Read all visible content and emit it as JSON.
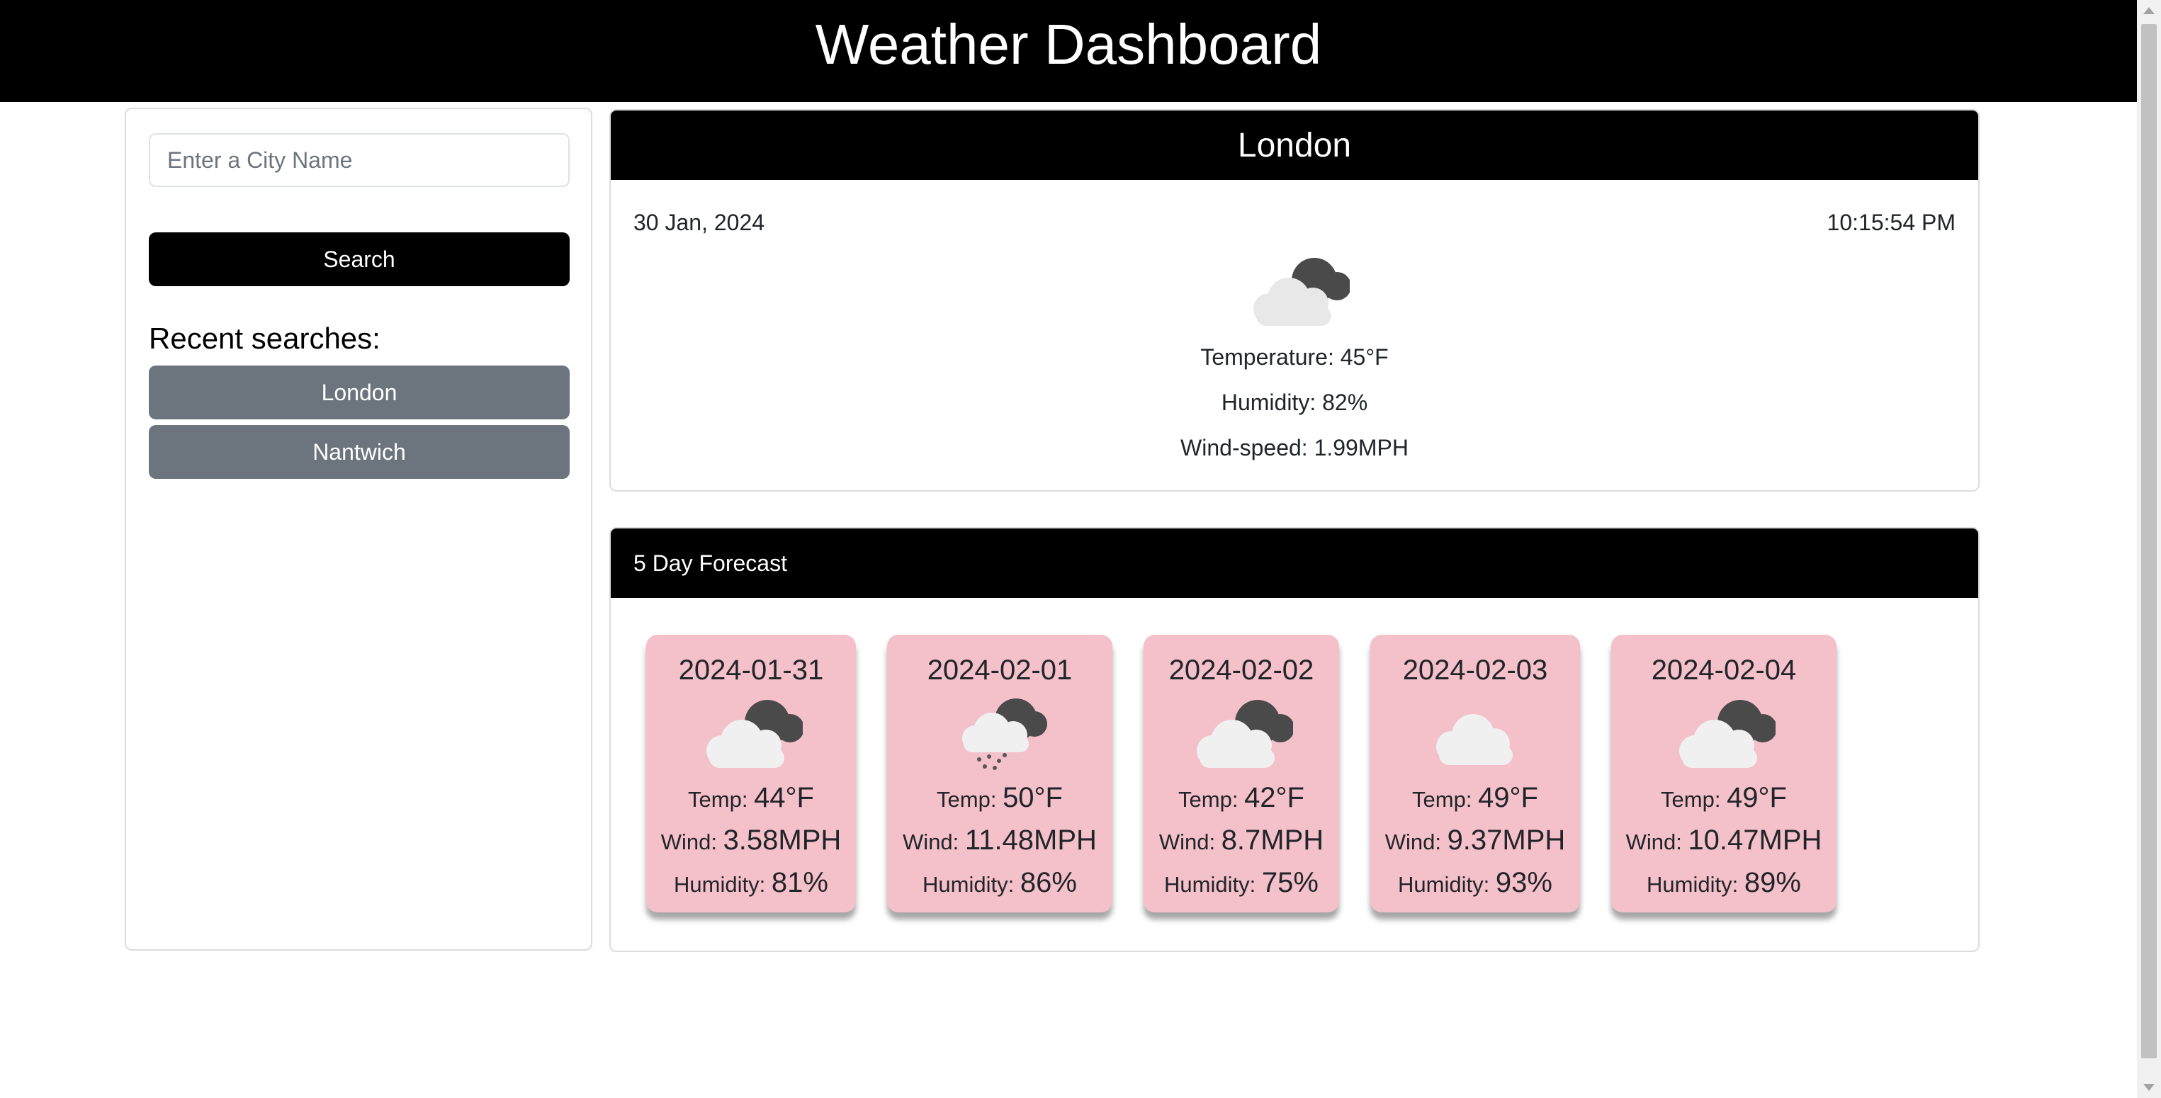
{
  "header": {
    "title": "Weather Dashboard"
  },
  "sidebar": {
    "search_placeholder": "Enter a City Name",
    "search_value": "",
    "search_label": "Search",
    "recent_label": "Recent searches:",
    "recent": [
      "London",
      "Nantwich"
    ]
  },
  "current": {
    "city": "London",
    "date": "30 Jan, 2024",
    "time": "10:15:54 PM",
    "icon": "cloud-moon-icon",
    "temperature": "Temperature: 45°F",
    "humidity": "Humidity: 82%",
    "wind": "Wind-speed: 1.99MPH"
  },
  "forecast": {
    "title": "5 Day Forecast",
    "temp_label": "Temp:",
    "wind_label": "Wind:",
    "humidity_label": "Humidity:",
    "days": [
      {
        "date": "2024-01-31",
        "icon": "cloud-moon-icon",
        "temp": "44°F",
        "wind": "3.58MPH",
        "humidity": "81%"
      },
      {
        "date": "2024-02-01",
        "icon": "snow-cloud-moon-icon",
        "temp": "50°F",
        "wind": "11.48MPH",
        "humidity": "86%"
      },
      {
        "date": "2024-02-02",
        "icon": "cloud-moon-icon",
        "temp": "42°F",
        "wind": "8.7MPH",
        "humidity": "75%"
      },
      {
        "date": "2024-02-03",
        "icon": "cloud-icon",
        "temp": "49°F",
        "wind": "9.37MPH",
        "humidity": "93%"
      },
      {
        "date": "2024-02-04",
        "icon": "cloud-moon-icon",
        "temp": "49°F",
        "wind": "10.47MPH",
        "humidity": "89%"
      }
    ]
  },
  "colors": {
    "header_bg": "#000000",
    "recent_button_bg": "#6c757d",
    "forecast_card_bg": "#f4c0ca"
  }
}
